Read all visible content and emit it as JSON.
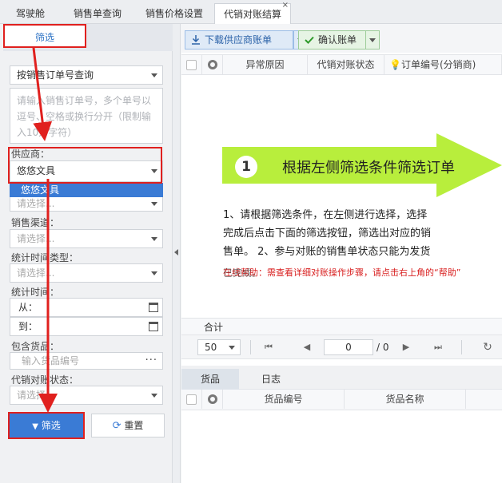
{
  "tabs": [
    {
      "label": "驾驶舱"
    },
    {
      "label": "销售单查询"
    },
    {
      "label": "销售价格设置"
    },
    {
      "label": "代销对账结算",
      "close": "×"
    }
  ],
  "filter": {
    "tab_label": "筛选",
    "query_type": "按销售订单号查询",
    "order_placeholder": "请输入销售订单号，多个单号以逗号、空格或换行分开（限制输入10万字符）",
    "supplier_label": "供应商：",
    "supplier_value": "悠悠文具",
    "supplier_option": "悠悠文具",
    "hidden_select_placeholder": "请选择...",
    "channel_label": "销售渠道：",
    "channel_placeholder": "请选择...",
    "time_type_label": "统计时间类型：",
    "time_type_placeholder": "请选择...",
    "time_label": "统计时间：",
    "from_label": "从：",
    "to_label": "到：",
    "goods_label": "包含货品：",
    "goods_placeholder": "输入货品编号",
    "goods_more": "···",
    "status_label": "代销对账状态：",
    "status_placeholder": "请选择...",
    "filter_button": "筛选",
    "reset_button": "重置"
  },
  "toolbar": {
    "download_label": "下载供应商账单",
    "confirm_label": "确认账单"
  },
  "grid": {
    "columns": [
      "异常原因",
      "代销对账状态",
      "订单编号(分销商)"
    ]
  },
  "guide": {
    "step_number": "1",
    "step_title": "根据左侧筛选条件筛选订单",
    "instructions": "1、请根据筛选条件，在左侧进行选择，选择完成后点击下面的筛选按钮，筛选出对应的销售单。 2、参与对账的销售单状态只能为发货",
    "note": "在线帮助：需查看详细对账操作步骤，请点击右上角的“帮助”",
    "status_tail": "已完成。"
  },
  "total": {
    "label": "合计"
  },
  "pager": {
    "page_size": "50",
    "page_value": "0",
    "page_total": "/ 0"
  },
  "detail_tabs": [
    {
      "label": "货品"
    },
    {
      "label": "日志"
    }
  ],
  "detail_grid": {
    "columns": [
      "货品编号",
      "货品名称"
    ]
  },
  "colors": {
    "accent_blue": "#3a7bd5",
    "annotation_red": "#e0201e",
    "banner_green": "#b8ee3c"
  }
}
